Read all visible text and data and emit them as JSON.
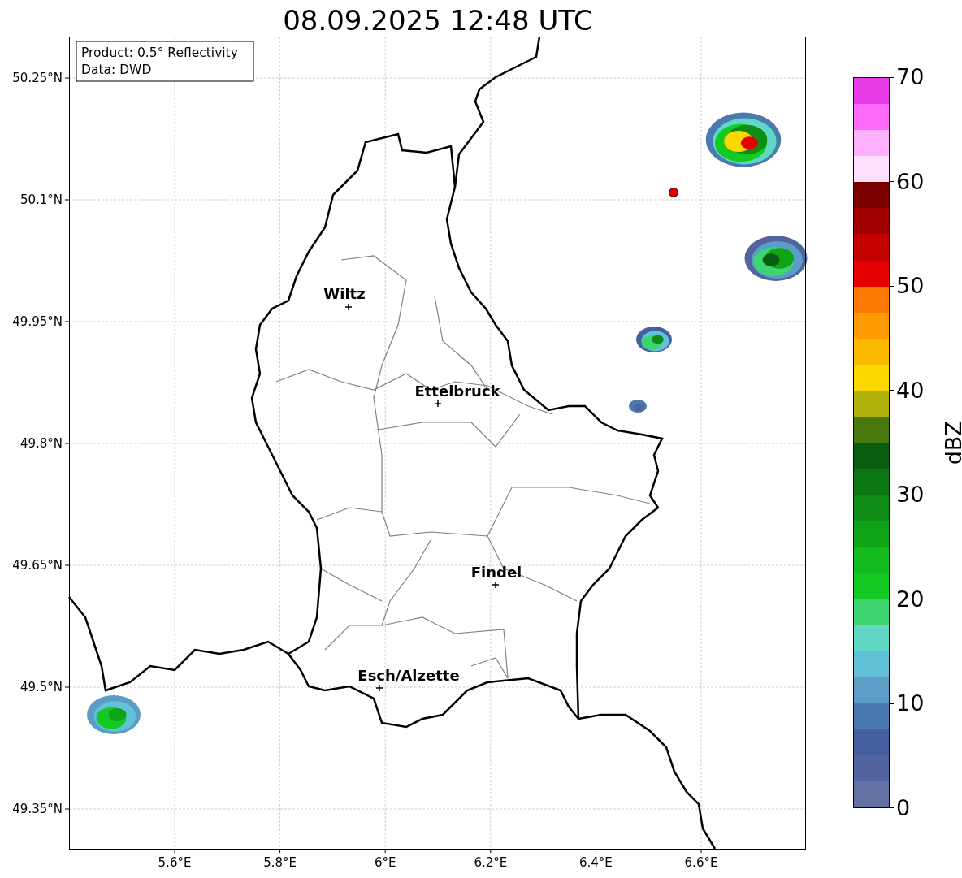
{
  "title": "08.09.2025 12:48 UTC",
  "info_box": [
    "Product: 0.5° Reflectivity",
    "Data: DWD"
  ],
  "y_ticks": [
    "50.25°N",
    "50.1°N",
    "49.95°N",
    "49.8°N",
    "49.65°N",
    "49.5°N",
    "49.35°N"
  ],
  "x_ticks": [
    "5.6°E",
    "5.8°E",
    "6°E",
    "6.2°E",
    "6.4°E",
    "6.6°E"
  ],
  "cities": [
    {
      "name": "Wiltz"
    },
    {
      "name": "Ettelbruck"
    },
    {
      "name": "Findel"
    },
    {
      "name": "Esch/Alzette"
    }
  ],
  "colorbar": {
    "label": "dBZ",
    "ticks": [
      "70",
      "60",
      "50",
      "40",
      "30",
      "20",
      "10",
      "0"
    ],
    "segments": [
      {
        "color": "#e83be8"
      },
      {
        "color": "#fc6bfc"
      },
      {
        "color": "#feb0fe"
      },
      {
        "color": "#fee0fe"
      },
      {
        "color": "#7b0000"
      },
      {
        "color": "#a20000"
      },
      {
        "color": "#c40000"
      },
      {
        "color": "#e40000"
      },
      {
        "color": "#fd7c00"
      },
      {
        "color": "#fd9b00"
      },
      {
        "color": "#fcb900"
      },
      {
        "color": "#fdd800"
      },
      {
        "color": "#b0b20a"
      },
      {
        "color": "#48780c"
      },
      {
        "color": "#085e0e"
      },
      {
        "color": "#0b7612"
      },
      {
        "color": "#0e8c16"
      },
      {
        "color": "#10a318"
      },
      {
        "color": "#12bb1e"
      },
      {
        "color": "#13c922"
      },
      {
        "color": "#3dd56f"
      },
      {
        "color": "#5fd7c3"
      },
      {
        "color": "#62c1d9"
      },
      {
        "color": "#5b9dc6"
      },
      {
        "color": "#4a7ab0"
      },
      {
        "color": "#4560a0"
      },
      {
        "color": "#52649e"
      },
      {
        "color": "#6272a5"
      }
    ]
  }
}
